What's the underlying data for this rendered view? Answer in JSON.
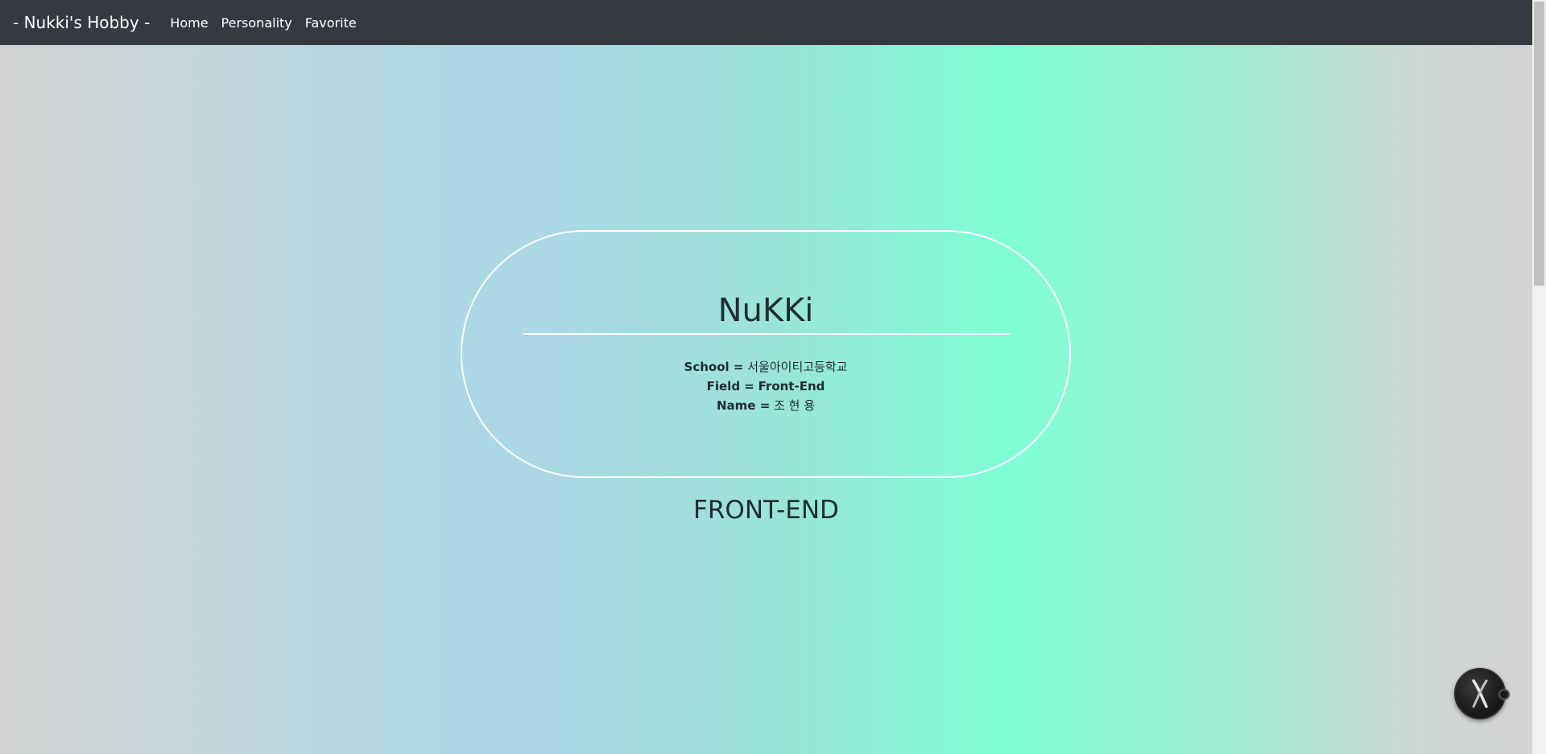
{
  "navbar": {
    "brand": "- Nukki's Hobby -",
    "links": [
      "Home",
      "Personality",
      "Favorite"
    ]
  },
  "profile": {
    "title": "NuKKi",
    "rows": [
      {
        "label": "School =",
        "value": "서울아이티고등학교"
      },
      {
        "label": "Field =",
        "value": "Front-End"
      },
      {
        "label": "Name =",
        "value": "조 현 용"
      }
    ]
  },
  "section_title": "FRONT-END",
  "colors": {
    "navbar_bg": "#343a40",
    "gradient": [
      "#d3d3d3",
      "#add8e6",
      "#7fffd4",
      "#d3d3d3"
    ],
    "text": "#1f2d33"
  },
  "floating_button": {
    "icon": "x-figure-icon"
  }
}
